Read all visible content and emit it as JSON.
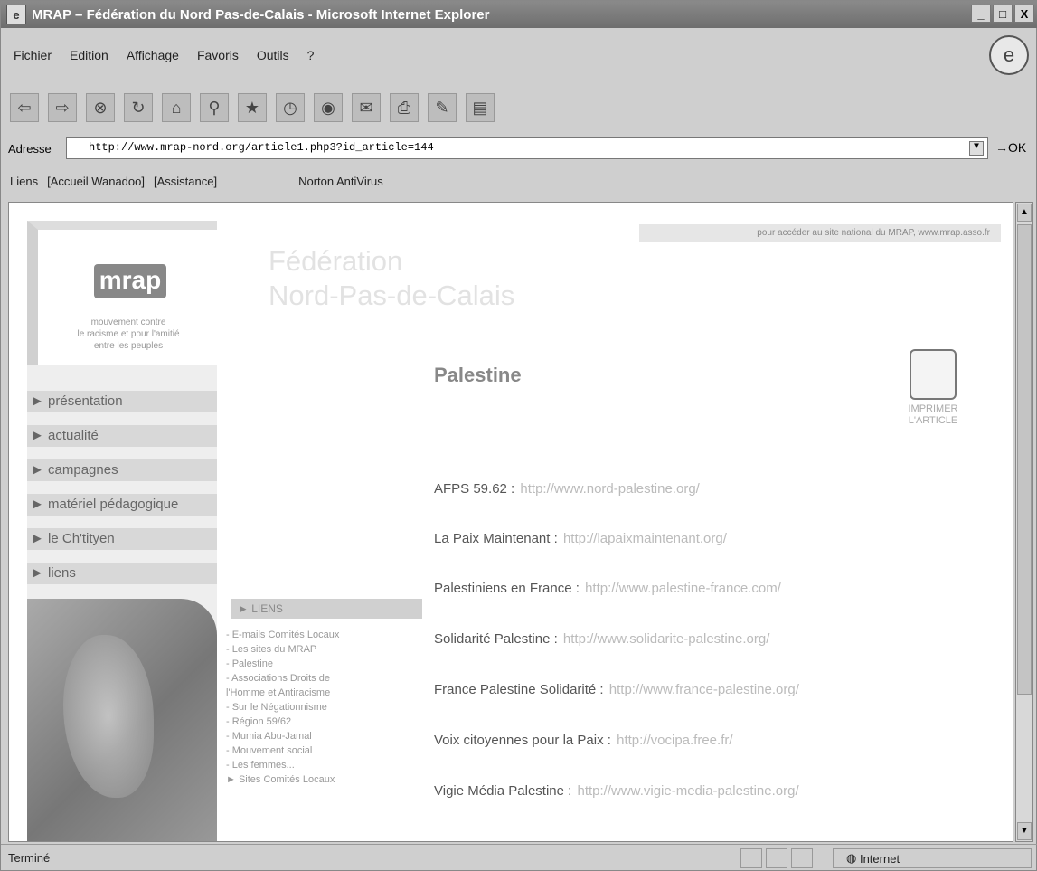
{
  "window": {
    "title": "MRAP – Fédération du Nord Pas-de-Calais - Microsoft Internet Explorer",
    "buttons": {
      "minimize": "_",
      "maximize": "□",
      "close": "X"
    }
  },
  "menu": {
    "items": [
      "Fichier",
      "Edition",
      "Affichage",
      "Favoris",
      "Outils",
      "?"
    ]
  },
  "address": {
    "label": "Adresse",
    "url": "http://www.mrap-nord.org/article1.php3?id_article=144",
    "go": "OK"
  },
  "links_bar": {
    "label": "Liens",
    "items": [
      "[Accueil Wanadoo]",
      "[Assistance]",
      "Norton AntiVirus"
    ]
  },
  "status": {
    "text": "Terminé",
    "zone": "Internet"
  },
  "page": {
    "banner": "pour accéder au site national du MRAP, www.mrap.asso.fr",
    "logo": "mrap",
    "logo_sub": [
      "mouvement contre",
      "le racisme et pour l'amitié",
      "entre les peuples"
    ],
    "fed_title": [
      "Fédération",
      "Nord-Pas-de-Calais"
    ],
    "nav": [
      "► présentation",
      "► actualité",
      "► campagnes",
      "► matériel pédagogique",
      "► le Ch'tityen",
      "► liens"
    ],
    "article_title": "Palestine",
    "print_label": [
      "IMPRIMER",
      "L'ARTICLE"
    ],
    "links": [
      {
        "name": "AFPS 59.62 :",
        "url": "http://www.nord-palestine.org/"
      },
      {
        "name": "La Paix Maintenant :",
        "url": "http://lapaixmaintenant.org/"
      },
      {
        "name": "Palestiniens en France :",
        "url": "http://www.palestine-france.com/"
      },
      {
        "name": "Solidarité Palestine :",
        "url": "http://www.solidarite-palestine.org/"
      },
      {
        "name": "France Palestine Solidarité :",
        "url": "http://www.france-palestine.org/"
      },
      {
        "name": "Voix citoyennes pour la Paix :",
        "url": "http://vocipa.free.fr/"
      },
      {
        "name": "Vigie Média Palestine :",
        "url": "http://www.vigie-media-palestine.org/"
      }
    ],
    "liens_head": "► LIENS",
    "liens_list": [
      "- E-mails Comités Locaux",
      "- Les sites du MRAP",
      "- Palestine",
      "- Associations Droits de",
      "l'Homme et Antiracisme",
      "- Sur le Négationnisme",
      "- Région 59/62",
      "- Mumia Abu-Jamal",
      "- Mouvement social",
      "- Les femmes...",
      "► Sites Comités Locaux"
    ]
  }
}
